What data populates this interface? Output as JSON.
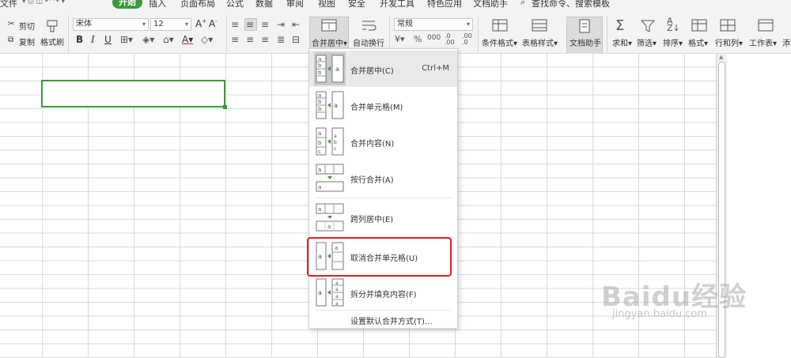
{
  "menubar": {
    "items": [
      "文件",
      "开始",
      "插入",
      "页面布局",
      "公式",
      "数据",
      "审阅",
      "视图",
      "安全",
      "开发工具",
      "特色应用",
      "文档助手"
    ],
    "active": "开始",
    "search_placeholder": "查找命令、搜索模板"
  },
  "ribbon": {
    "cut": "剪切",
    "copy": "复制",
    "format_painter": "格式刷",
    "font_name": "宋体",
    "font_size": "12",
    "merge_center": "合并居中",
    "wrap_text": "自动换行",
    "number_format": "常规",
    "conditional_format": "条件格式",
    "table_style": "表格样式",
    "doc_assistant": "文档助手",
    "sum": "求和",
    "filter": "筛选",
    "sort": "排序",
    "format": "格式",
    "rows_cols": "行和列",
    "worksheet": "工作表",
    "more": "添"
  },
  "dropdown": {
    "items": [
      {
        "label": "合并居中(C)",
        "shortcut": "Ctrl+M"
      },
      {
        "label": "合并单元格(M)"
      },
      {
        "label": "合并内容(N)"
      },
      {
        "label": "按行合并(A)"
      },
      {
        "label": "跨列居中(E)"
      },
      {
        "label": "取消合并单元格(U)"
      },
      {
        "label": "拆分并填充内容(F)"
      }
    ],
    "settings": "设置默认合并方式(T)..."
  },
  "watermark": {
    "brand": "Baidu经验",
    "url": "jingyan.baidu.com"
  },
  "colors": {
    "accent_green": "#3c9a3c",
    "highlight_red": "#e0201e"
  }
}
